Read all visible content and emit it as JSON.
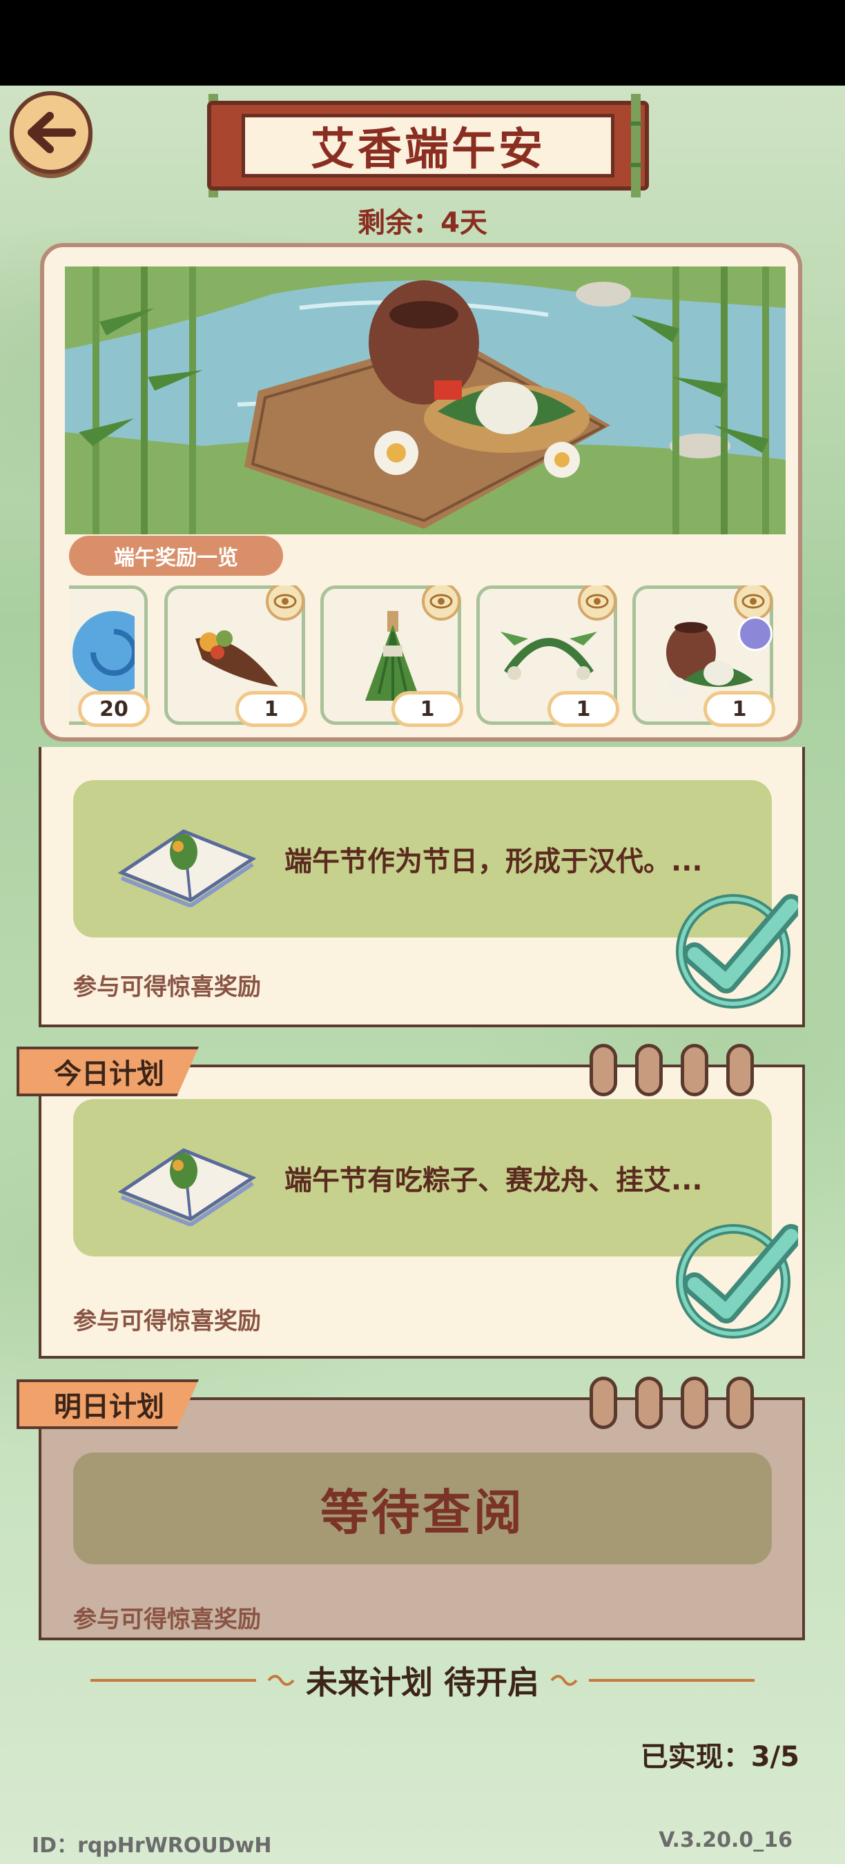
{
  "header": {
    "title": "艾香端午安",
    "remaining": "剩余：4天"
  },
  "banner": {
    "reward_list_label": "端午奖励一览",
    "rewards": [
      {
        "icon": "blue-swirl-icon",
        "count": "20"
      },
      {
        "icon": "cornucopia-icon",
        "count": "1"
      },
      {
        "icon": "herb-bundle-icon",
        "count": "1"
      },
      {
        "icon": "leaf-headband-icon",
        "count": "1"
      },
      {
        "icon": "jar-zongzi-icon",
        "count": "1"
      }
    ]
  },
  "plans": {
    "previous": {
      "task": "端午节作为节日，形成于汉代。...",
      "hint": "参与可得惊喜奖励"
    },
    "today": {
      "label": "今日计划",
      "task": "端午节有吃粽子、赛龙舟、挂艾...",
      "hint": "参与可得惊喜奖励"
    },
    "tomorrow": {
      "label": "明日计划",
      "waiting": "等待查阅",
      "hint": "参与可得惊喜奖励"
    }
  },
  "future": "未来计划 待开启",
  "achieved": "已实现：3/5",
  "footer": {
    "id": "ID：rqpHrWROUDwH",
    "version": "V.3.20.0_16"
  },
  "colors": {
    "accent_orange": "#f0a26a",
    "title_red": "#8a2e22",
    "task_green": "#c6d18e",
    "check_teal": "#5cb9a0"
  }
}
